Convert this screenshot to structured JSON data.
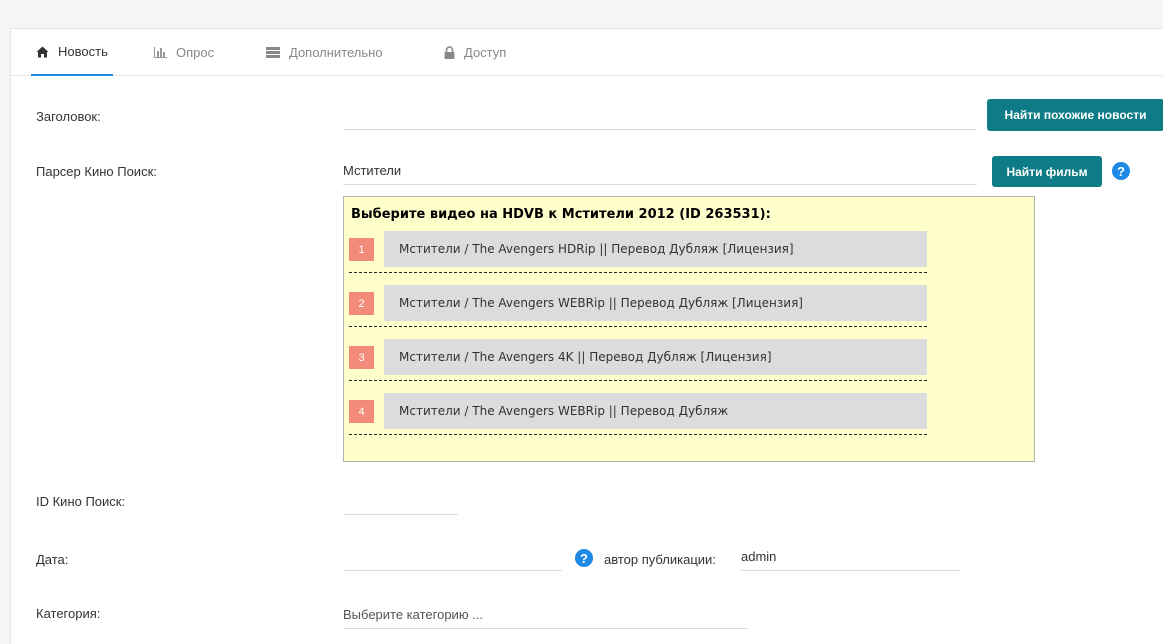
{
  "tabs": [
    {
      "label": "Новость",
      "icon": "home-icon",
      "active": true
    },
    {
      "label": "Опрос",
      "icon": "bar-chart-icon",
      "active": false
    },
    {
      "label": "Дополнительно",
      "icon": "list-icon",
      "active": false
    },
    {
      "label": "Доступ",
      "icon": "lock-icon",
      "active": false
    }
  ],
  "form": {
    "title_label": "Заголовок:",
    "title_value": "",
    "find_similar_button": "Найти похожие новости",
    "parser_label": "Парсер Кино Поиск:",
    "parser_value": "Мстители",
    "find_film_button": "Найти фильм",
    "help_glyph": "?",
    "results": {
      "title": "Выберите видео на HDVB к Мстители 2012 (ID 263531):",
      "items": [
        {
          "num": "1",
          "title": "Мстители / The Avengers HDRip || Перевод Дубляж [Лицензия]"
        },
        {
          "num": "2",
          "title": "Мстители / The Avengers WEBRip || Перевод Дубляж [Лицензия]"
        },
        {
          "num": "3",
          "title": "Мстители / The Avengers 4K || Перевод Дубляж [Лицензия]"
        },
        {
          "num": "4",
          "title": "Мстители / The Avengers WEBRip || Перевод Дубляж"
        }
      ]
    },
    "kp_id_label": "ID Кино Поиск:",
    "kp_id_value": "",
    "date_label": "Дата:",
    "date_value": "",
    "author_label": "автор публикации:",
    "author_value": "admin",
    "category_label": "Категория:",
    "category_placeholder": "Выберите категорию ..."
  },
  "colors": {
    "accent": "#0e7c86",
    "tab_underline": "#1e88e5",
    "help_icon": "#1e88e5",
    "results_bg": "#ffffcc",
    "item_number_bg": "#f28b7a",
    "item_bg": "#dcdcdc"
  }
}
